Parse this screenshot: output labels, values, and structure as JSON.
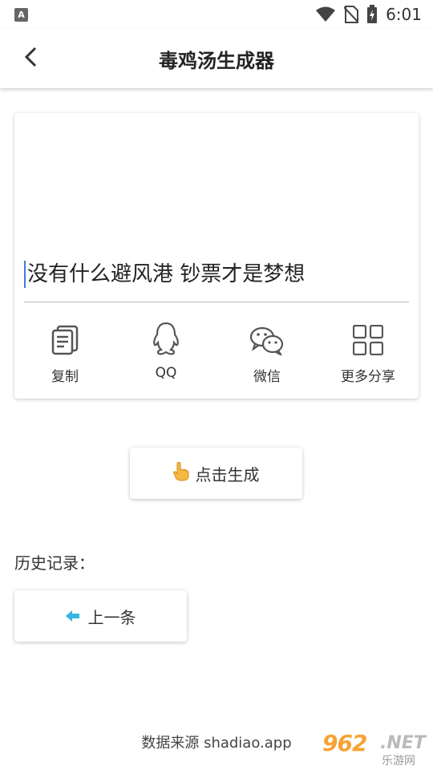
{
  "status_bar": {
    "app_badge": "A",
    "time": "6:01"
  },
  "toolbar": {
    "title": "毒鸡汤生成器"
  },
  "card": {
    "quote": "没有什么避风港 钞票才是梦想",
    "share": [
      {
        "label": "复制",
        "icon": "copy-icon"
      },
      {
        "label": "QQ",
        "icon": "qq-icon"
      },
      {
        "label": "微信",
        "icon": "wechat-icon"
      },
      {
        "label": "更多分享",
        "icon": "grid-icon"
      }
    ]
  },
  "generate": {
    "label": "点击生成",
    "icon": "pointing-hand-icon"
  },
  "history": {
    "title": "历史记录：",
    "prev_label": "上一条",
    "prev_icon": "arrow-left-icon"
  },
  "footer": {
    "source": "数据来源 shadiao.app"
  },
  "watermark": {
    "main": "962",
    "net": ".NET",
    "sub": "乐游网"
  },
  "colors": {
    "accent_arrow": "#36b5e0",
    "cursor": "#3b7ddd",
    "watermark": "#f7a233"
  }
}
